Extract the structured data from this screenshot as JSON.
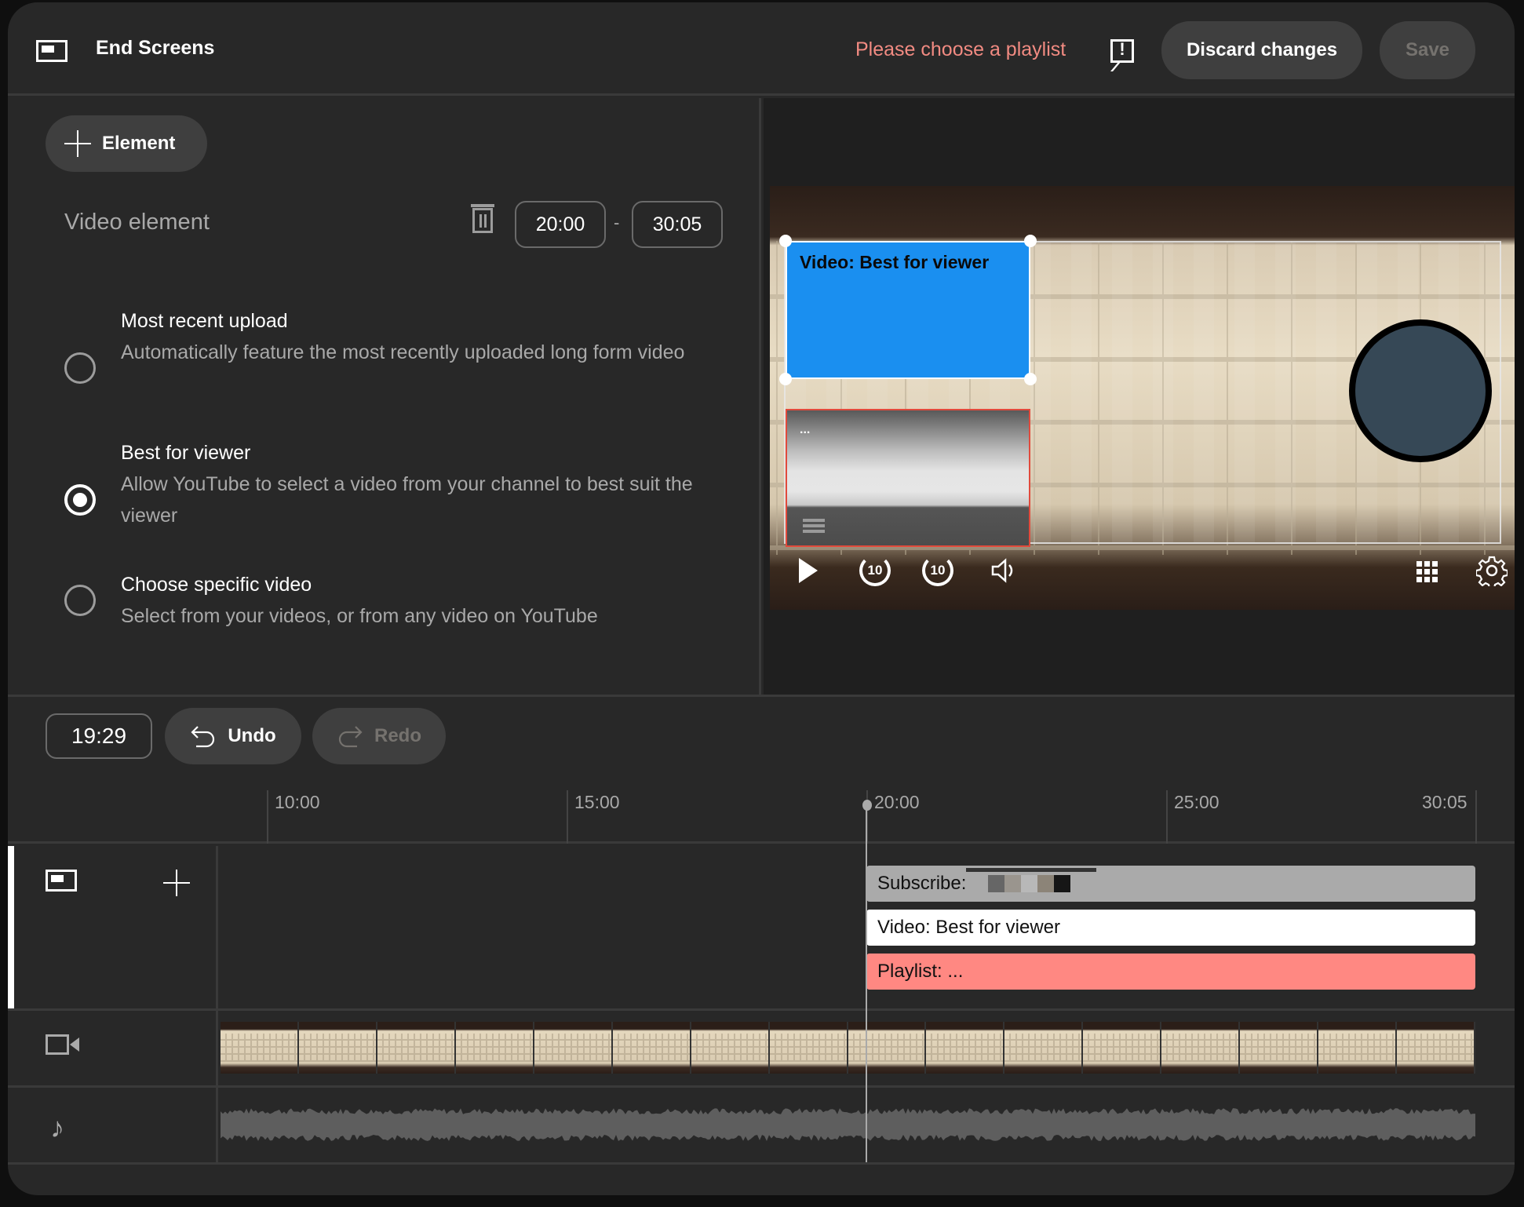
{
  "header": {
    "title": "End Screens",
    "warning": "Please choose a playlist",
    "discard_label": "Discard changes",
    "save_label": "Save"
  },
  "editor": {
    "add_element_label": "Element",
    "element_label": "Video element",
    "start_time": "20:00",
    "separator": "-",
    "end_time": "30:05",
    "options": [
      {
        "title": "Most recent upload",
        "description": "Automatically feature the most recently uploaded long form video",
        "selected": false
      },
      {
        "title": "Best for viewer",
        "description": "Allow YouTube to select a video from your channel to best suit the viewer",
        "selected": true
      },
      {
        "title": "Choose specific video",
        "description": "Select from your videos, or from any video on YouTube",
        "selected": false
      }
    ]
  },
  "preview": {
    "video_element_label": "Video: Best for viewer",
    "playlist_element_label": "...",
    "rewind_label": "10",
    "forward_label": "10",
    "colors": {
      "video_element": "#1a8ff0",
      "playlist_border": "#e14a3c",
      "subscribe_circle": "#364856"
    }
  },
  "timeline": {
    "current_time": "19:29",
    "undo_label": "Undo",
    "redo_label": "Redo",
    "ticks": [
      "10:00",
      "15:00",
      "20:00",
      "25:00",
      "30:05"
    ],
    "playhead_time": "20:00",
    "elements": [
      {
        "label": "Subscribe:",
        "color": "#aaaaaa"
      },
      {
        "label": "Video: Best for viewer",
        "color": "#ffffff"
      },
      {
        "label": "Playlist: ...",
        "color": "#ff8882"
      }
    ]
  }
}
